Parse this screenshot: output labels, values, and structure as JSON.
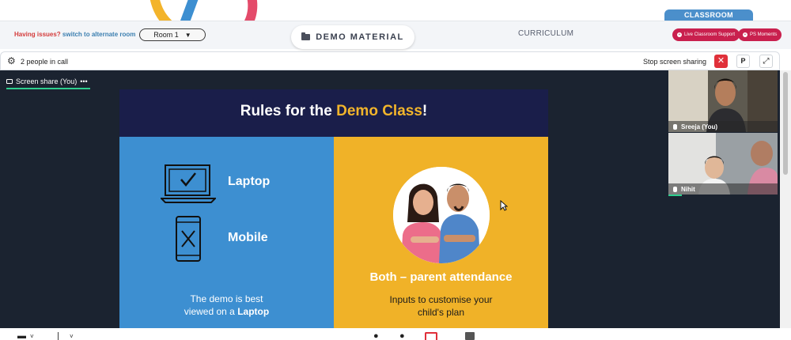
{
  "topbar": {
    "issues_text": "Having issues?",
    "alternate_room_link": "switch to alternate room",
    "room_selected": "Room 1",
    "demo_material_label": "DEMO MATERIAL",
    "curriculum_label": "CURRICULUM",
    "classroom_label": "CLASSROOM",
    "live_support_label": "Live Classroom Support",
    "ps_moments_label": "PS Moments"
  },
  "callbar": {
    "people_in_call": "2 people in call",
    "stop_sharing_label": "Stop screen sharing",
    "close_button": "✕",
    "pin_button": "P",
    "expand_button": "⤢"
  },
  "stage": {
    "share_tab_label": "Screen share (You)",
    "share_tab_more": "•••"
  },
  "slide": {
    "title_part1": "Rules for the ",
    "title_highlight": "Demo Class",
    "title_part2": "!",
    "laptop_label": "Laptop",
    "mobile_label": "Mobile",
    "demo_note_line1": "The demo is best",
    "demo_note_line2_prefix": "viewed on a ",
    "demo_note_line2_bold": "Laptop",
    "both_label": "Both – parent attendance",
    "inputs_line1": "Inputs to customise your",
    "inputs_line2": "child's plan"
  },
  "participants": [
    {
      "name": "Sreeja (You)"
    },
    {
      "name": "Nihit"
    }
  ],
  "colors": {
    "slide_head": "#1a1e4a",
    "slide_highlight": "#f2b52b",
    "panel_left": "#3d8fd1",
    "panel_right": "#f0b228",
    "stage_bg": "#1b2330",
    "accent_green": "#2ecf8f",
    "danger_red": "#e0303a",
    "pill_pink": "#c9204e"
  }
}
